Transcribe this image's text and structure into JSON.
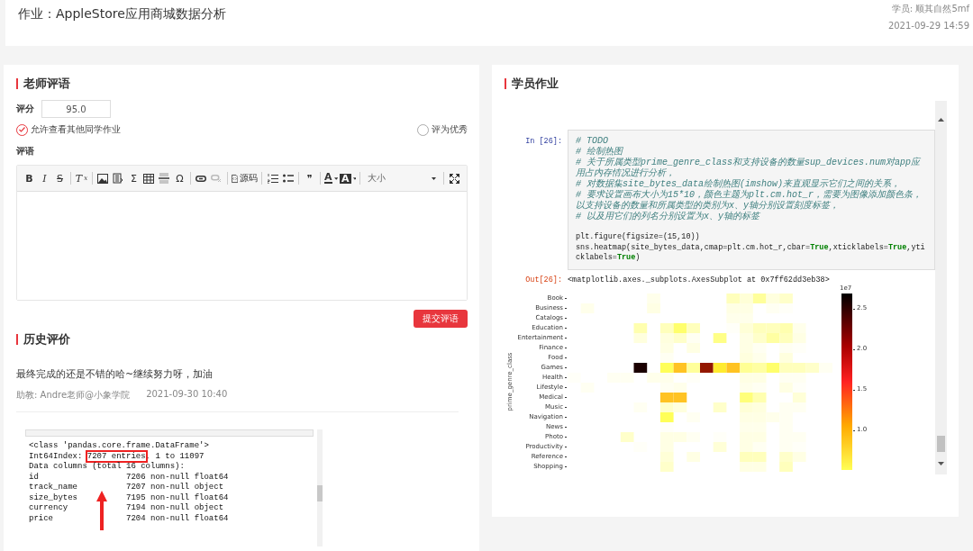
{
  "header": {
    "title": "作业：AppleStore应用商城数据分析",
    "student": "学员: 顺其自然5mf",
    "date": "2021-09-29 14:59"
  },
  "teacher_review": {
    "heading": "老师评语",
    "score_label": "评分",
    "score": "95.0",
    "allow_view": {
      "label": "允许查看其他同学作业",
      "checked": true
    },
    "excellent": {
      "label": "评为优秀",
      "selected": false
    },
    "comment_label": "评语",
    "toolbar": [
      {
        "kind": "bold",
        "text": "B"
      },
      {
        "kind": "italic",
        "text": "I"
      },
      {
        "kind": "strike",
        "text": "S"
      },
      {
        "kind": "sep"
      },
      {
        "kind": "clearformat",
        "text": "T",
        "sub": "x"
      },
      {
        "kind": "sep"
      },
      {
        "kind": "icon",
        "disabled": false
      },
      {
        "kind": "icon",
        "disabled": false
      },
      {
        "kind": "symbol",
        "text": "Σ"
      },
      {
        "kind": "icon",
        "disabled": false
      },
      {
        "kind": "icon",
        "disabled": false
      },
      {
        "kind": "symbol",
        "text": "Ω"
      },
      {
        "kind": "sep"
      },
      {
        "kind": "icon",
        "disabled": false
      },
      {
        "kind": "icon",
        "disabled": true
      },
      {
        "kind": "sep"
      },
      {
        "kind": "labeled",
        "text": "源码"
      },
      {
        "kind": "sep"
      },
      {
        "kind": "icon",
        "disabled": false
      },
      {
        "kind": "icon",
        "disabled": false
      },
      {
        "kind": "sep"
      },
      {
        "kind": "symbol",
        "text": "❞"
      },
      {
        "kind": "sep"
      },
      {
        "kind": "forecolor",
        "text": "A"
      },
      {
        "kind": "backcolor",
        "text": "A"
      },
      {
        "kind": "sep"
      },
      {
        "kind": "select",
        "text": "大小"
      },
      {
        "kind": "sep"
      },
      {
        "kind": "icon",
        "disabled": false
      }
    ],
    "submit": "提交评语"
  },
  "history": {
    "heading": "历史评价",
    "comment": "最终完成的还是不错的哈~继续努力呀，加油",
    "author": "助教: Andre老师@小象学院",
    "date": "2021-09-30 10:40",
    "screenshot_lines": [
      {
        "text": "<class 'pandas.core.frame.DataFrame'>"
      },
      {
        "text": "Int64Index: ",
        "highlight": "7207 entries",
        "after": ", 1 to 11097"
      },
      {
        "text": "Data columns (total 16 columns):"
      },
      {
        "text": "id                  7206 non-null float64"
      },
      {
        "text": "track_name          7207 non-null object"
      },
      {
        "text": "size_bytes          7195 non-null float64"
      },
      {
        "text": "currency            7194 non-null object"
      },
      {
        "text": "price               7204 non-null float64"
      }
    ]
  },
  "student_work": {
    "heading": "学员作业",
    "cell": {
      "prompt": "In  [26]:",
      "lines": [
        {
          "kind": "comment",
          "text": "# TODO"
        },
        {
          "kind": "comment",
          "text": "# 绘制热图"
        },
        {
          "kind": "comment",
          "text": "# 关于所属类型prime_genre_class和支持设备的数量sup_devices.num对app应用占内存情况进行分析，"
        },
        {
          "kind": "comment",
          "text": "# 对数据集site_bytes_data绘制热图(imshow)来直观显示它们之间的关系，"
        },
        {
          "kind": "comment",
          "text": "# 要求设置画布大小为15*10，颜色主题为plt.cm.hot_r，需要为图像添加颜色条，以支持设备的数量和所属类型的类别为x、y轴分别设置刻度标签，"
        },
        {
          "kind": "comment",
          "text": "# 以及用它们的列名分别设置为x、y轴的标签"
        },
        {
          "kind": "code",
          "tokens": [
            {
              "kind": "plain",
              "text": "plt.figure(figsize=(15,10))"
            }
          ]
        },
        {
          "kind": "code",
          "tokens": [
            {
              "kind": "plain",
              "text": "sns.heatmap(site_bytes_data,cmap=plt.cm.hot_r,cbar="
            },
            {
              "kind": "keyword",
              "text": "True"
            },
            {
              "kind": "plain",
              "text": ",xticklabels="
            },
            {
              "kind": "keyword",
              "text": "True"
            },
            {
              "kind": "plain",
              "text": ",yticklabels="
            },
            {
              "kind": "keyword",
              "text": "True"
            },
            {
              "kind": "plain",
              "text": ")"
            }
          ]
        }
      ]
    },
    "output": {
      "prompt": "Out[26]:",
      "text": "<matplotlib.axes._subplots.AxesSubplot at 0x7ff62dd3eb38>",
      "heatmap": {
        "ylabel": "prime_genre_class",
        "rows": [
          "Book",
          "Business",
          "Catalogs",
          "Education",
          "Entertainment",
          "Finance",
          "Food",
          "Games",
          "Health",
          "Lifestyle",
          "Medical",
          "Music",
          "Navigation",
          "News",
          "Photo",
          "Productivity",
          "Reference",
          "Shopping"
        ],
        "colorbar_exponent": "1e7",
        "colorbar_ticks": [
          "2.5",
          "2.0",
          "1.5",
          "1.0"
        ]
      }
    }
  }
}
